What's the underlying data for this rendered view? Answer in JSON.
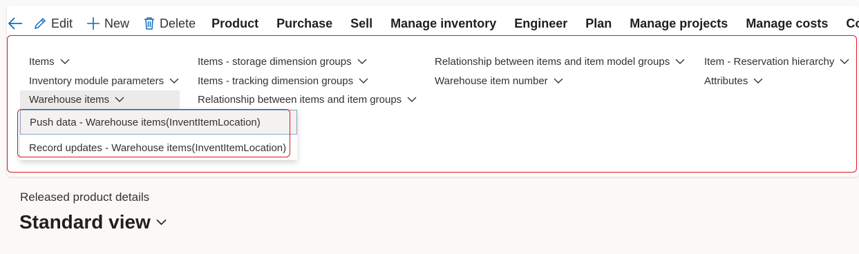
{
  "toolbar": {
    "edit_label": "Edit",
    "new_label": "New",
    "delete_label": "Delete",
    "tabs": [
      "Product",
      "Purchase",
      "Sell",
      "Manage inventory",
      "Engineer",
      "Plan",
      "Manage projects",
      "Manage costs",
      "Com"
    ]
  },
  "ribbon": {
    "col1": [
      "Items",
      "Inventory module parameters",
      "Warehouse items"
    ],
    "col2": [
      "Items - storage dimension groups",
      "Items - tracking dimension groups",
      "Relationship between items and item groups"
    ],
    "col3": [
      "Relationship between items and item model groups",
      "Warehouse item number"
    ],
    "col4": [
      "Item - Reservation hierarchy",
      "Attributes"
    ]
  },
  "dropdown": {
    "items": [
      "Push data - Warehouse items(InventItemLocation)",
      "Record updates - Warehouse items(InventItemLocation)"
    ]
  },
  "page": {
    "breadcrumb": "Released product details",
    "title": "Standard view"
  },
  "colors": {
    "accent": "#0f6cbd",
    "highlight_outline": "#e0151c"
  }
}
